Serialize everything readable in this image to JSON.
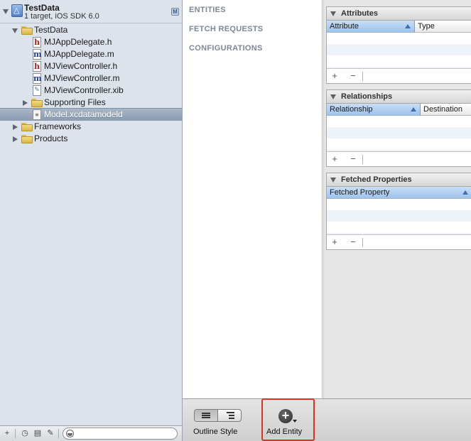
{
  "navigator": {
    "project": {
      "title": "TestData",
      "subtitle": "1 target, iOS SDK 6.0",
      "badge": "M"
    },
    "items": [
      {
        "label": "TestData",
        "kind": "folder",
        "expanded": true
      },
      {
        "label": "MJAppDelegate.h",
        "kind": "file-h",
        "glyph": "h"
      },
      {
        "label": "MJAppDelegate.m",
        "kind": "file-m",
        "glyph": "m"
      },
      {
        "label": "MJViewController.h",
        "kind": "file-h",
        "glyph": "h"
      },
      {
        "label": "MJViewController.m",
        "kind": "file-m",
        "glyph": "m"
      },
      {
        "label": "MJViewController.xib",
        "kind": "file-xib",
        "glyph": "✎"
      },
      {
        "label": "Supporting Files",
        "kind": "folder",
        "expanded": false
      },
      {
        "label": "Model.xcdatamodeld",
        "kind": "file-model",
        "glyph": "≡",
        "selected": true
      },
      {
        "label": "Frameworks",
        "kind": "folder",
        "expanded": false
      },
      {
        "label": "Products",
        "kind": "folder",
        "expanded": false
      }
    ],
    "bottom_icons": [
      "plus-icon",
      "clock-icon",
      "document-icon",
      "edit-icon",
      "filter-icon"
    ]
  },
  "outline": {
    "sections": [
      "ENTITIES",
      "FETCH REQUESTS",
      "CONFIGURATIONS"
    ]
  },
  "detail": {
    "attributes": {
      "title": "Attributes",
      "col1": "Attribute",
      "col2": "Type"
    },
    "relationships": {
      "title": "Relationships",
      "col1": "Relationship",
      "col2": "Destination"
    },
    "fetched": {
      "title": "Fetched Properties",
      "col1": "Fetched Property"
    },
    "add_glyph": "+",
    "remove_glyph": "−"
  },
  "bottom_bar": {
    "outline_style_label": "Outline Style",
    "add_entity_label": "Add Entity",
    "add_glyph": "+"
  },
  "colors": {
    "selection": "#8a9bb0",
    "highlight_box": "#e0311e",
    "column_sorted": "#9ec3ec"
  }
}
